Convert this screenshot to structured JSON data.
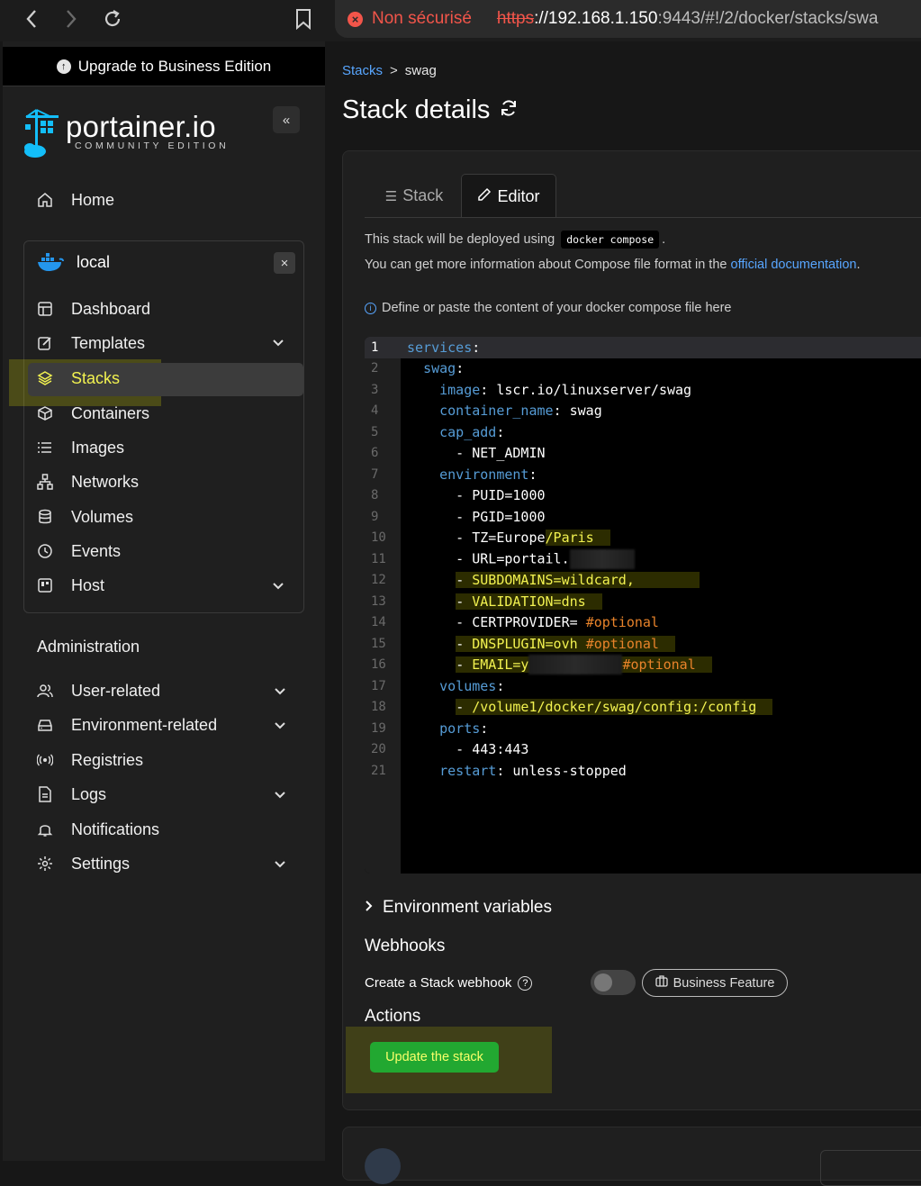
{
  "browser": {
    "insecure_label": "Non sécurisé",
    "url_scheme": "https",
    "url_host": "://192.168.1.150",
    "url_rest": ":9443/#!/2/docker/stacks/swa"
  },
  "sidebar": {
    "upgrade_label": "Upgrade to Business Edition",
    "logo_text": "portainer.io",
    "logo_subtitle": "COMMUNITY EDITION",
    "home_label": "Home",
    "environment_name": "local",
    "env_items": [
      {
        "label": "Dashboard"
      },
      {
        "label": "Templates"
      },
      {
        "label": "Stacks"
      },
      {
        "label": "Containers"
      },
      {
        "label": "Images"
      },
      {
        "label": "Networks"
      },
      {
        "label": "Volumes"
      },
      {
        "label": "Events"
      },
      {
        "label": "Host"
      }
    ],
    "admin_title": "Administration",
    "admin_items": [
      {
        "label": "User-related"
      },
      {
        "label": "Environment-related"
      },
      {
        "label": "Registries"
      },
      {
        "label": "Logs"
      },
      {
        "label": "Notifications"
      },
      {
        "label": "Settings"
      }
    ]
  },
  "main": {
    "breadcrumb_link": "Stacks",
    "breadcrumb_sep": ">",
    "breadcrumb_current": "swag",
    "title": "Stack details",
    "tabs": [
      {
        "label": "Stack"
      },
      {
        "label": "Editor"
      }
    ],
    "info_line1_pre": "This stack will be deployed using",
    "info_line1_code": "docker compose",
    "info_line1_post": ".",
    "info_line2_pre": "You can get more information about Compose file format in the ",
    "info_line2_link": "official documentation",
    "info_line2_post": ".",
    "hint": "Define or paste the content of your docker compose file here",
    "code_lines": [
      {
        "n": "1"
      },
      {
        "n": "2"
      },
      {
        "n": "3"
      },
      {
        "n": "4"
      },
      {
        "n": "5"
      },
      {
        "n": "6"
      },
      {
        "n": "7"
      },
      {
        "n": "8"
      },
      {
        "n": "9"
      },
      {
        "n": "10"
      },
      {
        "n": "11"
      },
      {
        "n": "12"
      },
      {
        "n": "13"
      },
      {
        "n": "14"
      },
      {
        "n": "15"
      },
      {
        "n": "16"
      },
      {
        "n": "17"
      },
      {
        "n": "18"
      },
      {
        "n": "19"
      },
      {
        "n": "20"
      },
      {
        "n": "21"
      }
    ],
    "code": {
      "l1_key": "services",
      "l2_key": "swag",
      "l3_key": "image",
      "l3_val": "lscr.io/linuxserver/swag",
      "l4_key": "container_name",
      "l4_val": "swag",
      "l5_key": "cap_add",
      "l6_val": "NET_ADMIN",
      "l7_key": "environment",
      "l8_val": "PUID=1000",
      "l9_val": "PGID=1000",
      "l10_val": "TZ=Europe",
      "l10_val2": "/Paris",
      "l11_val": "URL=portail.",
      "l12_val": "SUBDOMAINS=wildcard,",
      "l13_val": "VALIDATION=dns",
      "l14_val": "CERTPROVIDER=",
      "l14_comment": "#optional",
      "l15_val": "DNSPLUGIN=ovh",
      "l15_comment": "#optional",
      "l16_val": "EMAIL=y",
      "l16_comment": "#optional",
      "l17_key": "volumes",
      "l18_val": "/volume1/docker/swag/config:/config",
      "l19_key": "ports",
      "l20_val": "443:443",
      "l21_key": "restart",
      "l21_val": "unless-stopped"
    },
    "env_vars_label": "Environment variables",
    "webhooks_title": "Webhooks",
    "webhook_label": "Create a Stack webhook",
    "business_feature": "Business Feature",
    "actions_title": "Actions",
    "update_button": "Update the stack"
  },
  "colors": {
    "accent_link": "#58a6ff",
    "update_button_bg": "#22a831",
    "insecure_red": "#f2554a",
    "yaml_key": "#569cd6",
    "yaml_comment": "#e8832a"
  }
}
